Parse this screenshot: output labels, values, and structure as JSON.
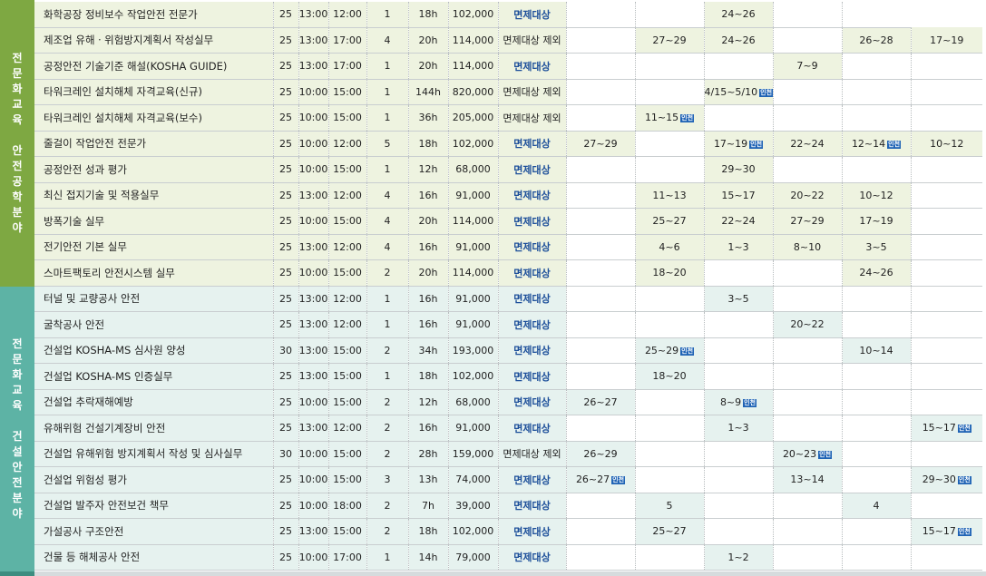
{
  "sections": [
    {
      "label": "전\n문\n화\n교\n육\n \n안\n전\n공\n학\n분\n야"
    },
    {
      "label": "전\n문\n화\n교\n육\n \n건\n설\n안\n전\n분\n야"
    }
  ],
  "badge_text": "인천",
  "rows": [
    {
      "group": 1,
      "name": "화학공장 정비보수 작업안전 전문가",
      "cap": "25",
      "start": "13:00",
      "end": "12:00",
      "days": "1",
      "hours": "18h",
      "fee": "102,000",
      "exempt": "면제대상",
      "m": [
        "",
        "",
        {
          "t": "24~26",
          "hl": true
        },
        "",
        ""
      ]
    },
    {
      "group": 1,
      "name": "제조업 유해ㆍ위험방지계획서 작성실무",
      "cap": "25",
      "start": "13:00",
      "end": "17:00",
      "days": "4",
      "hours": "20h",
      "fee": "114,000",
      "exempt": "면제대상 제외",
      "m": [
        "",
        {
          "t": "27~29",
          "hl": true
        },
        {
          "t": "24~26",
          "hl": true
        },
        "",
        {
          "t": "26~28",
          "hl": true
        },
        {
          "t": "17~19",
          "hl": true
        }
      ]
    },
    {
      "group": 1,
      "name": "공정안전 기술기준 해설(KOSHA GUIDE)",
      "cap": "25",
      "start": "13:00",
      "end": "17:00",
      "days": "1",
      "hours": "20h",
      "fee": "114,000",
      "exempt": "면제대상",
      "m": [
        "",
        "",
        "",
        {
          "t": "7~9",
          "hl": true
        },
        "",
        ""
      ]
    },
    {
      "group": 1,
      "name": "타워크레인 설치해체 자격교육(신규)",
      "cap": "25",
      "start": "10:00",
      "end": "15:00",
      "days": "1",
      "hours": "144h",
      "fee": "820,000",
      "exempt": "면제대상 제외",
      "m": [
        "",
        "",
        {
          "t": "4/15~5/10",
          "hl": true,
          "badge": true
        },
        "",
        "",
        ""
      ]
    },
    {
      "group": 1,
      "name": "타워크레인 설치해체 자격교육(보수)",
      "cap": "25",
      "start": "10:00",
      "end": "15:00",
      "days": "1",
      "hours": "36h",
      "fee": "205,000",
      "exempt": "면제대상 제외",
      "m": [
        "",
        {
          "t": "11~15",
          "hl": true,
          "badge": true
        },
        "",
        "",
        "",
        ""
      ]
    },
    {
      "group": 1,
      "name": "줄걸이 작업안전 전문가",
      "cap": "25",
      "start": "10:00",
      "end": "12:00",
      "days": "5",
      "hours": "18h",
      "fee": "102,000",
      "exempt": "면제대상",
      "m": [
        {
          "t": "27~29",
          "hl": true
        },
        "",
        {
          "t": "17~19",
          "hl": true,
          "badge": true
        },
        {
          "t": "22~24",
          "hl": true
        },
        {
          "t": "12~14",
          "hl": true,
          "badge": true
        },
        {
          "t": "10~12",
          "hl": true
        }
      ]
    },
    {
      "group": 1,
      "name": "공정안전 성과 평가",
      "cap": "25",
      "start": "10:00",
      "end": "15:00",
      "days": "1",
      "hours": "12h",
      "fee": "68,000",
      "exempt": "면제대상",
      "m": [
        "",
        "",
        {
          "t": "29~30",
          "hl": true
        },
        "",
        "",
        ""
      ]
    },
    {
      "group": 1,
      "name": "최신 접지기술 및 적용실무",
      "cap": "25",
      "start": "13:00",
      "end": "12:00",
      "days": "4",
      "hours": "16h",
      "fee": "91,000",
      "exempt": "면제대상",
      "m": [
        "",
        {
          "t": "11~13",
          "hl": true
        },
        {
          "t": "15~17",
          "hl": true
        },
        {
          "t": "20~22",
          "hl": true
        },
        {
          "t": "10~12",
          "hl": true
        },
        ""
      ]
    },
    {
      "group": 1,
      "name": "방폭기술 실무",
      "cap": "25",
      "start": "10:00",
      "end": "15:00",
      "days": "4",
      "hours": "20h",
      "fee": "114,000",
      "exempt": "면제대상",
      "m": [
        "",
        {
          "t": "25~27",
          "hl": true
        },
        {
          "t": "22~24",
          "hl": true
        },
        {
          "t": "27~29",
          "hl": true
        },
        {
          "t": "17~19",
          "hl": true
        },
        ""
      ]
    },
    {
      "group": 1,
      "name": "전기안전 기본 실무",
      "cap": "25",
      "start": "13:00",
      "end": "12:00",
      "days": "4",
      "hours": "16h",
      "fee": "91,000",
      "exempt": "면제대상",
      "m": [
        "",
        {
          "t": "4~6",
          "hl": true
        },
        {
          "t": "1~3",
          "hl": true
        },
        {
          "t": "8~10",
          "hl": true
        },
        {
          "t": "3~5",
          "hl": true
        },
        ""
      ]
    },
    {
      "group": 1,
      "name": "스마트팩토리 안전시스템 실무",
      "cap": "25",
      "start": "10:00",
      "end": "15:00",
      "days": "2",
      "hours": "20h",
      "fee": "114,000",
      "exempt": "면제대상",
      "m": [
        "",
        {
          "t": "18~20",
          "hl": true
        },
        "",
        "",
        {
          "t": "24~26",
          "hl": true
        },
        ""
      ]
    },
    {
      "group": 2,
      "name": "터널 및 교량공사 안전",
      "cap": "25",
      "start": "13:00",
      "end": "12:00",
      "days": "1",
      "hours": "16h",
      "fee": "91,000",
      "exempt": "면제대상",
      "m": [
        "",
        "",
        {
          "t": "3~5",
          "hl": true
        },
        "",
        "",
        ""
      ]
    },
    {
      "group": 2,
      "name": "굴착공사 안전",
      "cap": "25",
      "start": "13:00",
      "end": "12:00",
      "days": "1",
      "hours": "16h",
      "fee": "91,000",
      "exempt": "면제대상",
      "m": [
        "",
        "",
        "",
        {
          "t": "20~22",
          "hl": true
        },
        "",
        ""
      ]
    },
    {
      "group": 2,
      "name": "건설업  KOSHA-MS 심사원 양성",
      "cap": "30",
      "start": "13:00",
      "end": "15:00",
      "days": "2",
      "hours": "34h",
      "fee": "193,000",
      "exempt": "면제대상",
      "m": [
        "",
        {
          "t": "25~29",
          "hl": true,
          "badge": true
        },
        "",
        "",
        {
          "t": "10~14",
          "hl": true
        },
        ""
      ]
    },
    {
      "group": 2,
      "name": "건설업  KOSHA-MS 인증실무",
      "cap": "25",
      "start": "13:00",
      "end": "15:00",
      "days": "1",
      "hours": "18h",
      "fee": "102,000",
      "exempt": "면제대상",
      "m": [
        "",
        {
          "t": "18~20",
          "hl": true
        },
        "",
        "",
        "",
        ""
      ]
    },
    {
      "group": 2,
      "name": "건설업 추락재해예방",
      "cap": "25",
      "start": "10:00",
      "end": "15:00",
      "days": "2",
      "hours": "12h",
      "fee": "68,000",
      "exempt": "면제대상",
      "m": [
        {
          "t": "26~27",
          "hl": true
        },
        "",
        {
          "t": "8~9",
          "hl": true,
          "badge": true
        },
        "",
        "",
        ""
      ]
    },
    {
      "group": 2,
      "name": "유해위험 건설기계장비 안전",
      "cap": "25",
      "start": "13:00",
      "end": "12:00",
      "days": "2",
      "hours": "16h",
      "fee": "91,000",
      "exempt": "면제대상",
      "m": [
        "",
        "",
        {
          "t": "1~3",
          "hl": true
        },
        "",
        "",
        {
          "t": "15~17",
          "hl": true,
          "badge": true
        }
      ]
    },
    {
      "group": 2,
      "name": "건설업 유해위험 방지계획서 작성 및 심사실무",
      "cap": "30",
      "start": "10:00",
      "end": "15:00",
      "days": "2",
      "hours": "28h",
      "fee": "159,000",
      "exempt": "면제대상 제외",
      "m": [
        {
          "t": "26~29",
          "hl": true
        },
        "",
        "",
        {
          "t": "20~23",
          "hl": true,
          "badge": true
        },
        "",
        ""
      ]
    },
    {
      "group": 2,
      "name": "건설업 위험성 평가",
      "cap": "25",
      "start": "10:00",
      "end": "15:00",
      "days": "3",
      "hours": "13h",
      "fee": "74,000",
      "exempt": "면제대상",
      "m": [
        {
          "t": "26~27",
          "hl": true,
          "badge": true
        },
        "",
        "",
        {
          "t": "13~14",
          "hl": true
        },
        "",
        {
          "t": "29~30",
          "hl": true,
          "badge": true
        }
      ]
    },
    {
      "group": 2,
      "name": "건설업 발주자 안전보건 책무",
      "cap": "25",
      "start": "10:00",
      "end": "18:00",
      "days": "2",
      "hours": "7h",
      "fee": "39,000",
      "exempt": "면제대상",
      "m": [
        "",
        {
          "t": "5",
          "hl": true
        },
        "",
        "",
        {
          "t": "4",
          "hl": true
        },
        ""
      ]
    },
    {
      "group": 2,
      "name": "가설공사 구조안전",
      "cap": "25",
      "start": "13:00",
      "end": "15:00",
      "days": "2",
      "hours": "18h",
      "fee": "102,000",
      "exempt": "면제대상",
      "m": [
        "",
        {
          "t": "25~27",
          "hl": true
        },
        "",
        "",
        "",
        {
          "t": "15~17",
          "hl": true,
          "badge": true
        }
      ]
    },
    {
      "group": 2,
      "name": "건물 등 해체공사 안전",
      "cap": "25",
      "start": "10:00",
      "end": "17:00",
      "days": "1",
      "hours": "14h",
      "fee": "79,000",
      "exempt": "면제대상",
      "m": [
        "",
        "",
        {
          "t": "1~2",
          "hl": true
        },
        "",
        "",
        ""
      ]
    }
  ]
}
